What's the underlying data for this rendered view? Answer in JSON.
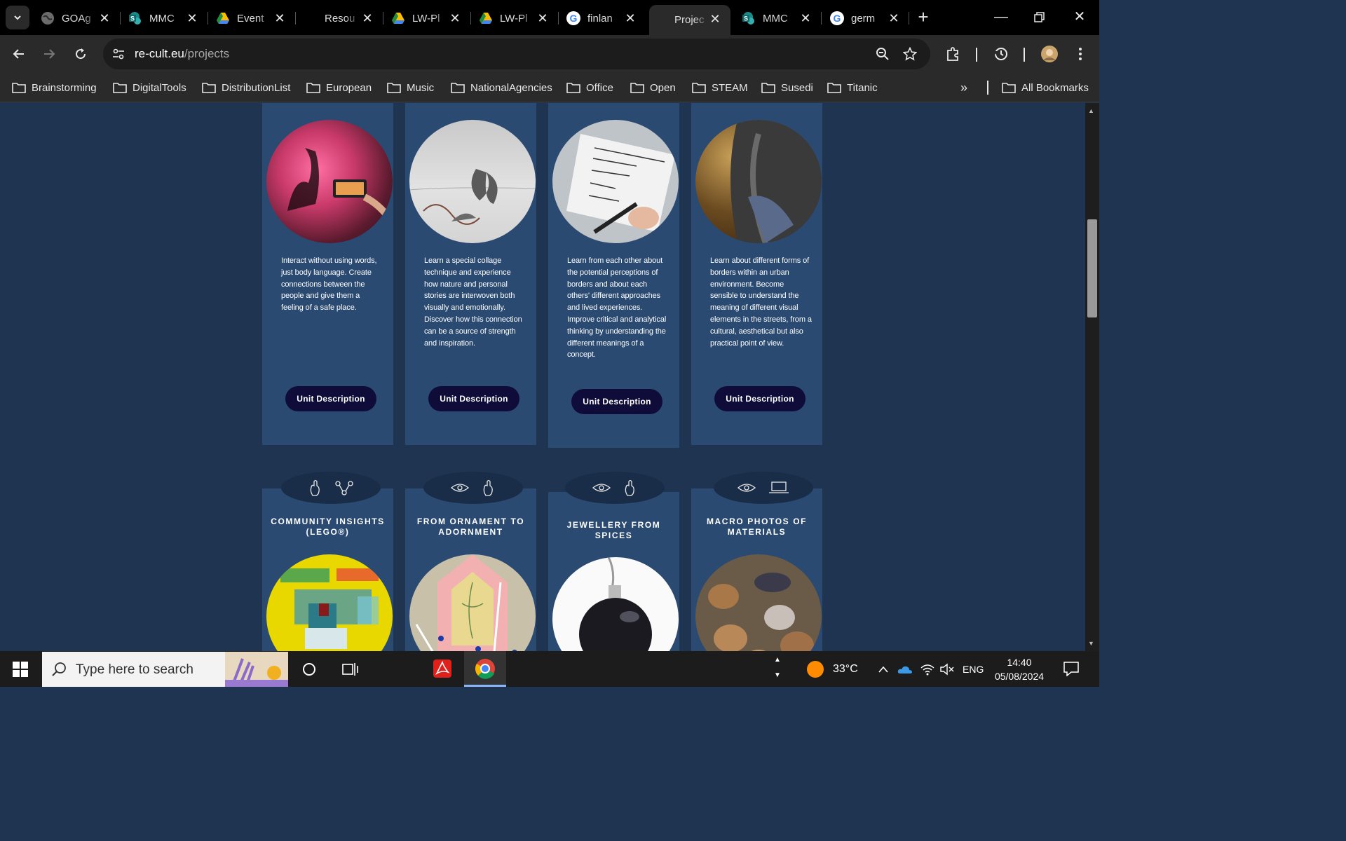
{
  "tabs": [
    {
      "title": "GOAg",
      "icon": "globe-icon"
    },
    {
      "title": "MMC",
      "icon": "sharepoint-icon"
    },
    {
      "title": "Event",
      "icon": "drive-icon"
    },
    {
      "title": "Resou",
      "icon": "none"
    },
    {
      "title": "LW-Pl",
      "icon": "drive-icon"
    },
    {
      "title": "LW-Pl",
      "icon": "drive-icon"
    },
    {
      "title": "finlan",
      "icon": "google-icon"
    },
    {
      "title": "Projec",
      "icon": "none",
      "active": true
    },
    {
      "title": "MMC",
      "icon": "sharepoint-icon"
    },
    {
      "title": "germ",
      "icon": "google-icon"
    }
  ],
  "address": {
    "domain": "re-cult.eu",
    "path": "/projects"
  },
  "bookmarks": [
    "Brainstorming",
    "DigitalTools",
    "DistributionList",
    "European",
    "Music",
    "NationalAgencies",
    "Office",
    "Open",
    "STEAM",
    "Susedi",
    "Titanic"
  ],
  "all_bookmarks": "All Bookmarks",
  "cards_top": [
    {
      "desc": "Interact without using words, just body language. Create connections between the people and give them a feeling of a safe place.",
      "button": "Unit Description"
    },
    {
      "desc": "Learn a special collage technique and experience how nature and personal stories are interwoven both visually and emotionally. Discover how this connection can be a source of strength and inspiration.",
      "button": "Unit Description"
    },
    {
      "desc": "Learn from each other about the potential perceptions of borders and about each others' different approaches and lived experiences. Improve critical and analytical thinking by understanding the different meanings of a concept.",
      "button": "Unit Description"
    },
    {
      "desc": "Learn about different forms of borders within an urban environment. Become sensible to understand the meaning of different visual elements in the streets, from a cultural, aesthetical but also practical point of view.",
      "button": "Unit Description"
    }
  ],
  "cards_bottom": [
    {
      "title": "COMMUNITY INSIGHTS (LEGO®)",
      "icons": [
        "hand-icon",
        "network-icon"
      ]
    },
    {
      "title": "FROM ORNAMENT TO ADORNMENT",
      "icons": [
        "eye-icon",
        "hand-icon"
      ]
    },
    {
      "title": "JEWELLERY FROM SPICES",
      "icons": [
        "eye-icon",
        "hand-icon"
      ]
    },
    {
      "title": "MACRO PHOTOS OF MATERIALS",
      "icons": [
        "eye-icon",
        "laptop-icon"
      ]
    }
  ],
  "taskbar": {
    "search_placeholder": "Type here to search",
    "temperature": "33°C",
    "language": "ENG",
    "time": "14:40",
    "date": "05/08/2024"
  },
  "colors": {
    "page_bg": "#1e3450",
    "card_bg": "#2a4a72",
    "button_bg": "#0f0c3a"
  }
}
